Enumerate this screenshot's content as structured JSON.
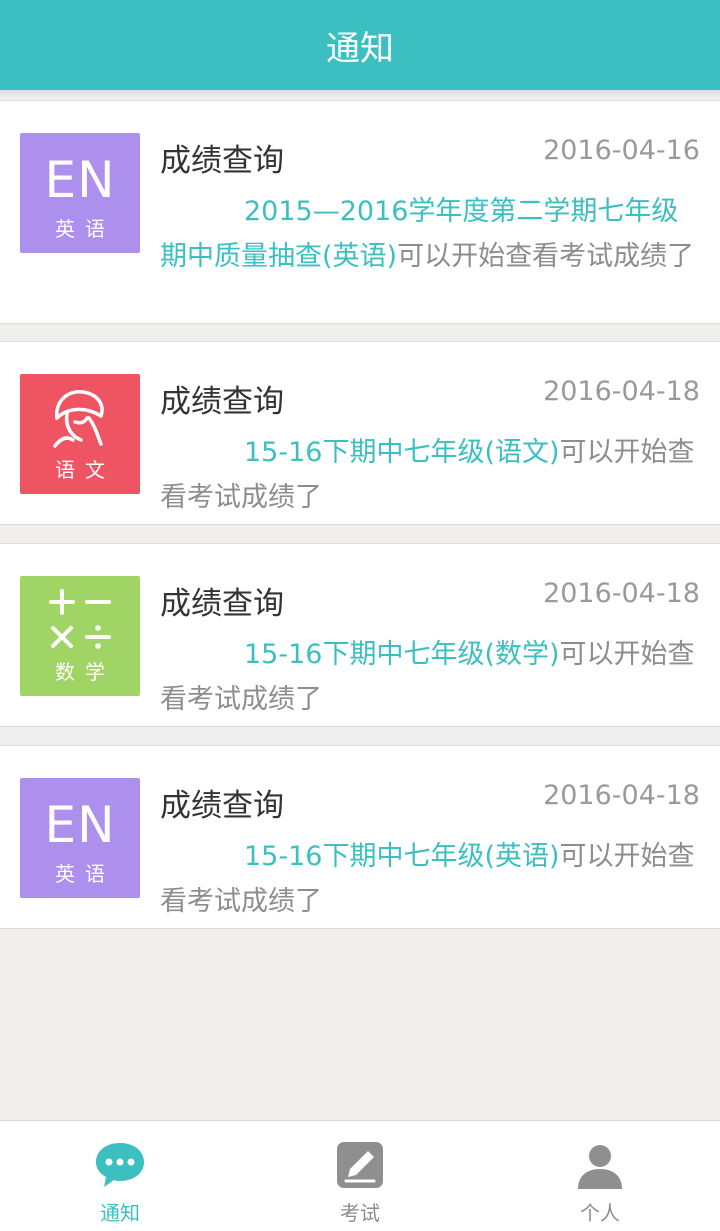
{
  "header": {
    "title": "通知"
  },
  "notifications": [
    {
      "badge_text": "EN",
      "subject": "英语",
      "badge_color": "#ad8fed",
      "title": "成绩查询",
      "date": "2016-04-16",
      "highlight": "2015—2016学年度第二学期七年级期中质量抽查(英语)",
      "rest": "可以开始查看考试成绩了"
    },
    {
      "badge_text": "",
      "subject": "语文",
      "badge_color": "#ef5463",
      "title": "成绩查询",
      "date": "2016-04-18",
      "highlight": "15-16下期中七年级(语文)",
      "rest": "可以开始查看考试成绩了"
    },
    {
      "badge_text": "",
      "subject": "数学",
      "badge_color": "#a0d465",
      "title": "成绩查询",
      "date": "2016-04-18",
      "highlight": "15-16下期中七年级(数学)",
      "rest": "可以开始查看考试成绩了"
    },
    {
      "badge_text": "EN",
      "subject": "英语",
      "badge_color": "#ad8fed",
      "title": "成绩查询",
      "date": "2016-04-18",
      "highlight": "15-16下期中七年级(英语)",
      "rest": "可以开始查看考试成绩了"
    }
  ],
  "tabs": [
    {
      "label": "通知",
      "icon": "chat-bubble-icon",
      "active": true
    },
    {
      "label": "考试",
      "icon": "edit-icon",
      "active": false
    },
    {
      "label": "个人",
      "icon": "person-icon",
      "active": false
    }
  ],
  "colors": {
    "accent": "#3bbfc1",
    "background": "#f1efed"
  }
}
